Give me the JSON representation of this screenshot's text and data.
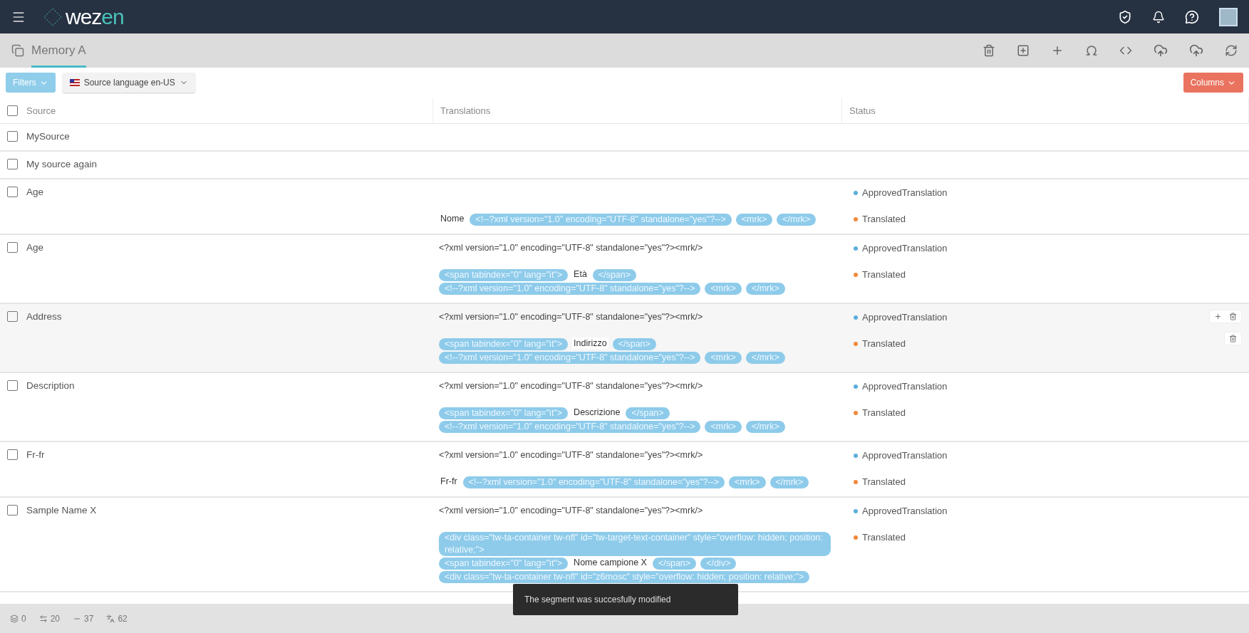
{
  "topbar": {
    "logo": {
      "first": "wez",
      "second": "en"
    }
  },
  "tab": {
    "label": "Memory A",
    "selected": true
  },
  "filters": {
    "filter_button": "Filters",
    "language_button": "Source language en-US",
    "columns_button": "Columns"
  },
  "table": {
    "select_all_checked": false,
    "columns": [
      "Source",
      "Translations",
      "Status"
    ],
    "rows": [
      {
        "source": "MySource",
        "checked": false,
        "hovered": false,
        "translations": []
      },
      {
        "source": "My source again",
        "checked": false,
        "hovered": false,
        "translations": []
      },
      {
        "source": "Age",
        "checked": false,
        "hovered": false,
        "translations": [
          {
            "status": "ApprovedTranslation",
            "color": "#5aaedc"
          },
          {
            "segments": [
              {
                "kind": "text",
                "text": "Nome"
              },
              {
                "kind": "tag",
                "text": "<!--?xml version=\"1.0\" encoding=\"UTF-8\" standalone=\"yes\"?-->"
              },
              {
                "kind": "tag",
                "text": "<mrk>"
              },
              {
                "kind": "tag",
                "text": "</mrk>"
              }
            ],
            "status": "Translated",
            "color": "#f0883a"
          }
        ]
      },
      {
        "source": "Age",
        "checked": false,
        "hovered": false,
        "translations": [
          {
            "segments": [
              {
                "kind": "plain",
                "text": "<?xml version=\"1.0\" encoding=\"UTF-8\" standalone=\"yes\"?><mrk/>"
              }
            ],
            "status": "ApprovedTranslation",
            "color": "#5aaedc"
          },
          {
            "segments": [
              {
                "kind": "tag",
                "text": "<span tabindex=\"0\" lang=\"it\">"
              },
              {
                "kind": "text",
                "text": "Età"
              },
              {
                "kind": "tag",
                "text": "</span>"
              },
              {
                "kind": "tag",
                "text": "<!--?xml version=\"1.0\" encoding=\"UTF-8\" standalone=\"yes\"?-->"
              },
              {
                "kind": "tag",
                "text": "<mrk>"
              },
              {
                "kind": "tag",
                "text": "</mrk>"
              }
            ],
            "status": "Translated",
            "color": "#f0883a"
          }
        ]
      },
      {
        "source": "Address",
        "checked": false,
        "hovered": true,
        "translations": [
          {
            "segments": [
              {
                "kind": "plain",
                "text": "<?xml version=\"1.0\" encoding=\"UTF-8\" standalone=\"yes\"?><mrk/>"
              }
            ],
            "status": "ApprovedTranslation",
            "color": "#5aaedc"
          },
          {
            "segments": [
              {
                "kind": "tag",
                "text": "<span tabindex=\"0\" lang=\"it\">"
              },
              {
                "kind": "text",
                "text": "Indirizzo"
              },
              {
                "kind": "tag",
                "text": "</span>"
              },
              {
                "kind": "tag",
                "text": "<!--?xml version=\"1.0\" encoding=\"UTF-8\" standalone=\"yes\"?-->"
              },
              {
                "kind": "tag",
                "text": "<mrk>"
              },
              {
                "kind": "tag",
                "text": "</mrk>"
              }
            ],
            "status": "Translated",
            "color": "#f0883a"
          }
        ]
      },
      {
        "source": "Description",
        "checked": false,
        "hovered": false,
        "translations": [
          {
            "segments": [
              {
                "kind": "plain",
                "text": "<?xml version=\"1.0\" encoding=\"UTF-8\" standalone=\"yes\"?><mrk/>"
              }
            ],
            "status": "ApprovedTranslation",
            "color": "#5aaedc"
          },
          {
            "segments": [
              {
                "kind": "tag",
                "text": "<span tabindex=\"0\" lang=\"it\">"
              },
              {
                "kind": "text",
                "text": "Descrizione"
              },
              {
                "kind": "tag",
                "text": "</span>"
              },
              {
                "kind": "tag",
                "text": "<!--?xml version=\"1.0\" encoding=\"UTF-8\" standalone=\"yes\"?-->"
              },
              {
                "kind": "tag",
                "text": "<mrk>"
              },
              {
                "kind": "tag",
                "text": "</mrk>"
              }
            ],
            "status": "Translated",
            "color": "#f0883a"
          }
        ]
      },
      {
        "source": "Fr-fr",
        "checked": false,
        "hovered": false,
        "translations": [
          {
            "segments": [
              {
                "kind": "plain",
                "text": "<?xml version=\"1.0\" encoding=\"UTF-8\" standalone=\"yes\"?><mrk/>"
              }
            ],
            "status": "ApprovedTranslation",
            "color": "#5aaedc"
          },
          {
            "segments": [
              {
                "kind": "text",
                "text": "Fr-fr"
              },
              {
                "kind": "tag",
                "text": "<!--?xml version=\"1.0\" encoding=\"UTF-8\" standalone=\"yes\"?-->"
              },
              {
                "kind": "tag",
                "text": "<mrk>"
              },
              {
                "kind": "tag",
                "text": "</mrk>"
              }
            ],
            "status": "Translated",
            "color": "#f0883a"
          }
        ]
      },
      {
        "source": "Sample Name X",
        "checked": false,
        "hovered": false,
        "translations": [
          {
            "segments": [
              {
                "kind": "plain",
                "text": "<?xml version=\"1.0\" encoding=\"UTF-8\" standalone=\"yes\"?><mrk/>"
              }
            ],
            "status": "ApprovedTranslation",
            "color": "#5aaedc"
          },
          {
            "segments": [
              {
                "kind": "tag",
                "text": "<div class=\"tw-ta-container tw-nfl\" id=\"tw-target-text-container\" style=\"overflow: hidden; position: relative;\">"
              },
              {
                "kind": "tag",
                "text": "<span tabindex=\"0\" lang=\"it\">"
              },
              {
                "kind": "text",
                "text": "Nome campione X"
              },
              {
                "kind": "tag",
                "text": "</span>"
              },
              {
                "kind": "tag",
                "text": "</div>"
              },
              {
                "kind": "tag",
                "text": "<div class=\"tw-ta-container tw-nfl\" id=\"z6mosc\" style=\"overflow: hidden; position: relative;\">"
              }
            ],
            "status": "Translated",
            "color": "#f0883a"
          }
        ]
      }
    ]
  },
  "toast": "The segment was succesfully modified",
  "footer": {
    "counts": [
      "0",
      "20",
      "37",
      "62"
    ]
  }
}
